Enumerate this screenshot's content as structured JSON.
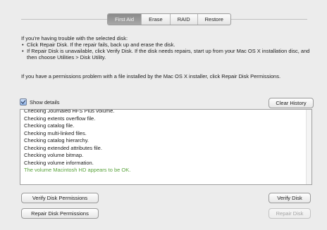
{
  "tabs": [
    "First Aid",
    "Erase",
    "RAID",
    "Restore"
  ],
  "active_tab": "First Aid",
  "intro": "If you're having trouble with the selected disk:",
  "bullets": [
    "Click Repair Disk. If the repair fails, back up and erase the disk.",
    "If Repair Disk is unavailable, click Verify Disk. If the disk needs repairs, start up from your Mac OS X installation disc, and then choose Utilities > Disk Utility."
  ],
  "permissions_text": "If you have a permissions problem with a file installed by the Mac OS X installer, click Repair Disk Permissions.",
  "show_details": {
    "label": "Show details",
    "checked": true
  },
  "clear_history_label": "Clear History",
  "log_lines": [
    "Checking Journaled HFS Plus volume.",
    "Checking extents overflow file.",
    "Checking catalog file.",
    "Checking multi-linked files.",
    "Checking catalog hierarchy.",
    "Checking extended attributes file.",
    "Checking volume bitmap.",
    "Checking volume information."
  ],
  "log_result": "The volume Macintosh HD appears to be OK.",
  "colors": {
    "ok_green": "#5aa33c",
    "active_tab": "#9a9a9a"
  },
  "buttons": {
    "verify_permissions": "Verify Disk Permissions",
    "repair_permissions": "Repair Disk Permissions",
    "verify_disk": "Verify Disk",
    "repair_disk": "Repair Disk"
  }
}
